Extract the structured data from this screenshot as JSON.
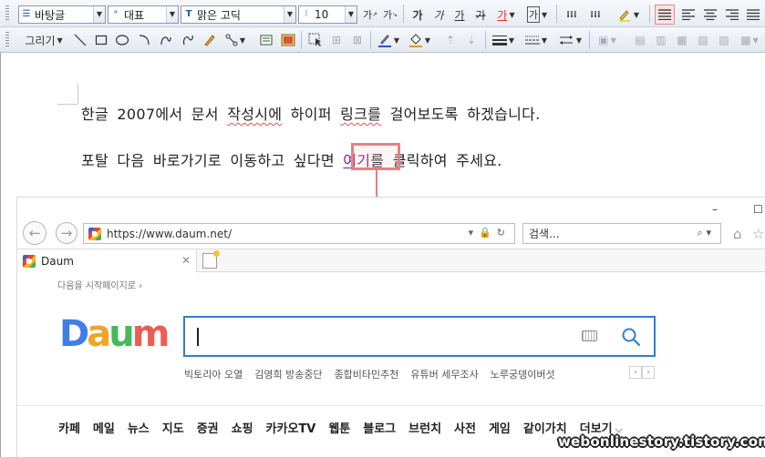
{
  "toolbar1": {
    "style_combo": "바탕글",
    "style_icon": "style-icon",
    "shape_combo": "대표",
    "shape_icon": "font-group-icon",
    "font_combo": "맑은 고딕",
    "font_icon": "truetype-icon",
    "size_combo": "10",
    "size_icon": "font-size-icon",
    "grow_label": "가",
    "shrink_label": "가",
    "bold_label": "가",
    "italic_label": "가",
    "underline_label": "가",
    "strike_label": "가",
    "color_label": "가",
    "shade_label": "가",
    "accent_color": "#e03030"
  },
  "toolbar2": {
    "draw_label": "그리기"
  },
  "document": {
    "para1_before": "한글 2007에서 문서 ",
    "para1_sq1": "작성시에",
    "para1_mid": " 하이퍼 ",
    "para1_sq2": "링크를",
    "para1_after": " 걸어보도록 하겠습니다.",
    "para2_before": "포탈 다음 바로가기로 이동하고 싶다면 ",
    "para2_link": "여기",
    "para2_after": "를 클릭하여 주세요.",
    "link_color": "#7b1c86",
    "highlight_color": "#ea7f85"
  },
  "browser": {
    "url": "https://www.daum.net/",
    "search_placeholder": "검색...",
    "tab_title": "Daum",
    "close_glyph": "✕",
    "window_min": "–",
    "window_max": "☐",
    "start_page_link": "다음을 시작페이지로 ›",
    "logo_letters": [
      "D",
      "a",
      "u",
      "m"
    ],
    "logo_colors": [
      "#3f7ee8",
      "#f0a52a",
      "#47b85c",
      "#ee5b55"
    ],
    "trending": [
      "빅토리아 오열",
      "김영희 방송중단",
      "종합비타민추천",
      "유튜버 세무조사",
      "노루궁뎅이버섯"
    ],
    "pager": [
      "‹",
      "›"
    ],
    "nav": [
      "카페",
      "메일",
      "뉴스",
      "지도",
      "증권",
      "쇼핑",
      "카카오TV",
      "웹툰",
      "블로그",
      "브런치",
      "사전",
      "게임",
      "같이가치",
      "더보기"
    ],
    "more_arrow": "⌵"
  },
  "watermark": "webonlinestory.tistory.com"
}
